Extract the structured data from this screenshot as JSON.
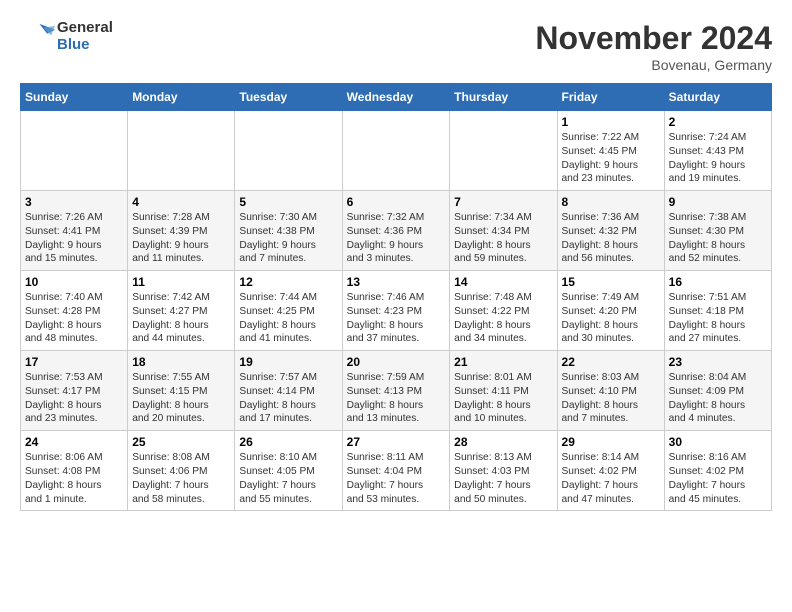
{
  "header": {
    "logo_line1": "General",
    "logo_line2": "Blue",
    "month": "November 2024",
    "location": "Bovenau, Germany"
  },
  "weekdays": [
    "Sunday",
    "Monday",
    "Tuesday",
    "Wednesday",
    "Thursday",
    "Friday",
    "Saturday"
  ],
  "weeks": [
    [
      {
        "day": "",
        "info": ""
      },
      {
        "day": "",
        "info": ""
      },
      {
        "day": "",
        "info": ""
      },
      {
        "day": "",
        "info": ""
      },
      {
        "day": "",
        "info": ""
      },
      {
        "day": "1",
        "info": "Sunrise: 7:22 AM\nSunset: 4:45 PM\nDaylight: 9 hours\nand 23 minutes."
      },
      {
        "day": "2",
        "info": "Sunrise: 7:24 AM\nSunset: 4:43 PM\nDaylight: 9 hours\nand 19 minutes."
      }
    ],
    [
      {
        "day": "3",
        "info": "Sunrise: 7:26 AM\nSunset: 4:41 PM\nDaylight: 9 hours\nand 15 minutes."
      },
      {
        "day": "4",
        "info": "Sunrise: 7:28 AM\nSunset: 4:39 PM\nDaylight: 9 hours\nand 11 minutes."
      },
      {
        "day": "5",
        "info": "Sunrise: 7:30 AM\nSunset: 4:38 PM\nDaylight: 9 hours\nand 7 minutes."
      },
      {
        "day": "6",
        "info": "Sunrise: 7:32 AM\nSunset: 4:36 PM\nDaylight: 9 hours\nand 3 minutes."
      },
      {
        "day": "7",
        "info": "Sunrise: 7:34 AM\nSunset: 4:34 PM\nDaylight: 8 hours\nand 59 minutes."
      },
      {
        "day": "8",
        "info": "Sunrise: 7:36 AM\nSunset: 4:32 PM\nDaylight: 8 hours\nand 56 minutes."
      },
      {
        "day": "9",
        "info": "Sunrise: 7:38 AM\nSunset: 4:30 PM\nDaylight: 8 hours\nand 52 minutes."
      }
    ],
    [
      {
        "day": "10",
        "info": "Sunrise: 7:40 AM\nSunset: 4:28 PM\nDaylight: 8 hours\nand 48 minutes."
      },
      {
        "day": "11",
        "info": "Sunrise: 7:42 AM\nSunset: 4:27 PM\nDaylight: 8 hours\nand 44 minutes."
      },
      {
        "day": "12",
        "info": "Sunrise: 7:44 AM\nSunset: 4:25 PM\nDaylight: 8 hours\nand 41 minutes."
      },
      {
        "day": "13",
        "info": "Sunrise: 7:46 AM\nSunset: 4:23 PM\nDaylight: 8 hours\nand 37 minutes."
      },
      {
        "day": "14",
        "info": "Sunrise: 7:48 AM\nSunset: 4:22 PM\nDaylight: 8 hours\nand 34 minutes."
      },
      {
        "day": "15",
        "info": "Sunrise: 7:49 AM\nSunset: 4:20 PM\nDaylight: 8 hours\nand 30 minutes."
      },
      {
        "day": "16",
        "info": "Sunrise: 7:51 AM\nSunset: 4:18 PM\nDaylight: 8 hours\nand 27 minutes."
      }
    ],
    [
      {
        "day": "17",
        "info": "Sunrise: 7:53 AM\nSunset: 4:17 PM\nDaylight: 8 hours\nand 23 minutes."
      },
      {
        "day": "18",
        "info": "Sunrise: 7:55 AM\nSunset: 4:15 PM\nDaylight: 8 hours\nand 20 minutes."
      },
      {
        "day": "19",
        "info": "Sunrise: 7:57 AM\nSunset: 4:14 PM\nDaylight: 8 hours\nand 17 minutes."
      },
      {
        "day": "20",
        "info": "Sunrise: 7:59 AM\nSunset: 4:13 PM\nDaylight: 8 hours\nand 13 minutes."
      },
      {
        "day": "21",
        "info": "Sunrise: 8:01 AM\nSunset: 4:11 PM\nDaylight: 8 hours\nand 10 minutes."
      },
      {
        "day": "22",
        "info": "Sunrise: 8:03 AM\nSunset: 4:10 PM\nDaylight: 8 hours\nand 7 minutes."
      },
      {
        "day": "23",
        "info": "Sunrise: 8:04 AM\nSunset: 4:09 PM\nDaylight: 8 hours\nand 4 minutes."
      }
    ],
    [
      {
        "day": "24",
        "info": "Sunrise: 8:06 AM\nSunset: 4:08 PM\nDaylight: 8 hours\nand 1 minute."
      },
      {
        "day": "25",
        "info": "Sunrise: 8:08 AM\nSunset: 4:06 PM\nDaylight: 7 hours\nand 58 minutes."
      },
      {
        "day": "26",
        "info": "Sunrise: 8:10 AM\nSunset: 4:05 PM\nDaylight: 7 hours\nand 55 minutes."
      },
      {
        "day": "27",
        "info": "Sunrise: 8:11 AM\nSunset: 4:04 PM\nDaylight: 7 hours\nand 53 minutes."
      },
      {
        "day": "28",
        "info": "Sunrise: 8:13 AM\nSunset: 4:03 PM\nDaylight: 7 hours\nand 50 minutes."
      },
      {
        "day": "29",
        "info": "Sunrise: 8:14 AM\nSunset: 4:02 PM\nDaylight: 7 hours\nand 47 minutes."
      },
      {
        "day": "30",
        "info": "Sunrise: 8:16 AM\nSunset: 4:02 PM\nDaylight: 7 hours\nand 45 minutes."
      }
    ]
  ]
}
